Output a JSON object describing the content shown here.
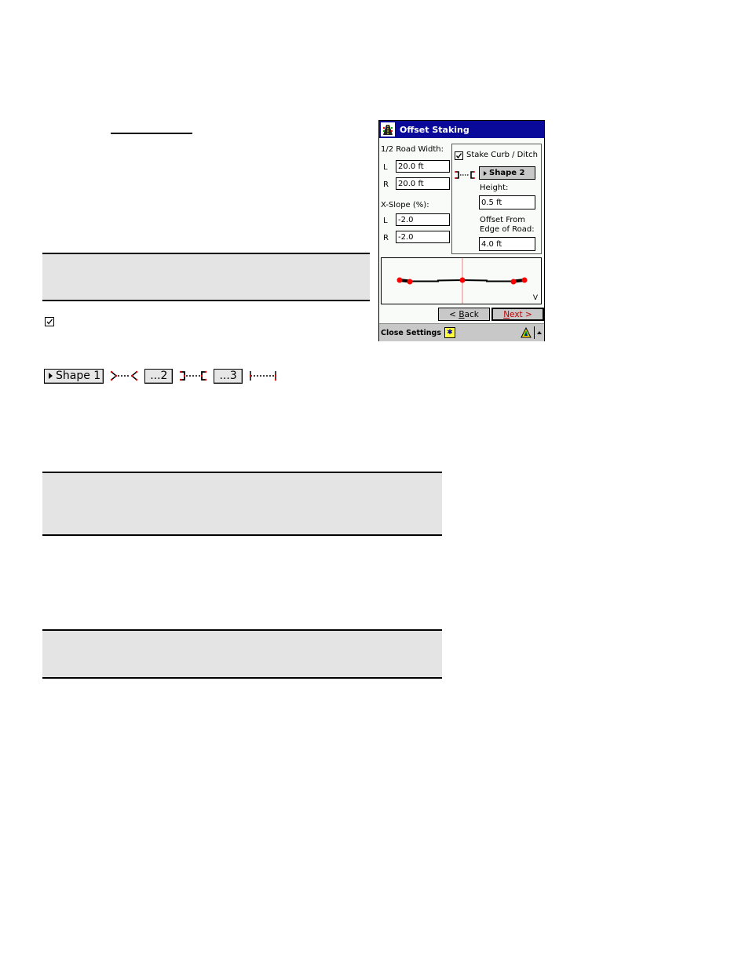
{
  "document": {
    "notes": [
      "",
      "",
      ""
    ],
    "shape_buttons": [
      {
        "label": "Shape 1",
        "has_arrow": true,
        "icon": "curb-shape-1-icon"
      },
      {
        "label": "...2",
        "has_arrow": false,
        "icon": "curb-shape-2-icon"
      },
      {
        "label": "...3",
        "has_arrow": false,
        "icon": "curb-shape-3-icon"
      }
    ]
  },
  "dialog": {
    "title": "Offset Staking",
    "title_icon": "road-app-icon",
    "road_width_label": "1/2 Road Width:",
    "left_label": "L",
    "right_label": "R",
    "road_width_left": "20.0 ft",
    "road_width_right": "20.0 ft",
    "xslope_label": "X-Slope (%):",
    "xslope_left": "-2.0",
    "xslope_right": "-2.0",
    "stake_curb_label": "Stake Curb / Ditch",
    "stake_curb_checked": true,
    "shape_button": "Shape 2",
    "height_label": "Height:",
    "height_value": "0.5 ft",
    "offset_label_1": "Offset From",
    "offset_label_2": "Edge of Road:",
    "offset_value": "4.0 ft",
    "preview_corner": "V",
    "back_label": "< Back",
    "next_label": "Next >",
    "status_text": "Close Settings",
    "colors": {
      "title_bar": "#0a0a9a",
      "next_text": "#c00000",
      "point": "#ff0000",
      "centerline": "#f08080"
    }
  }
}
